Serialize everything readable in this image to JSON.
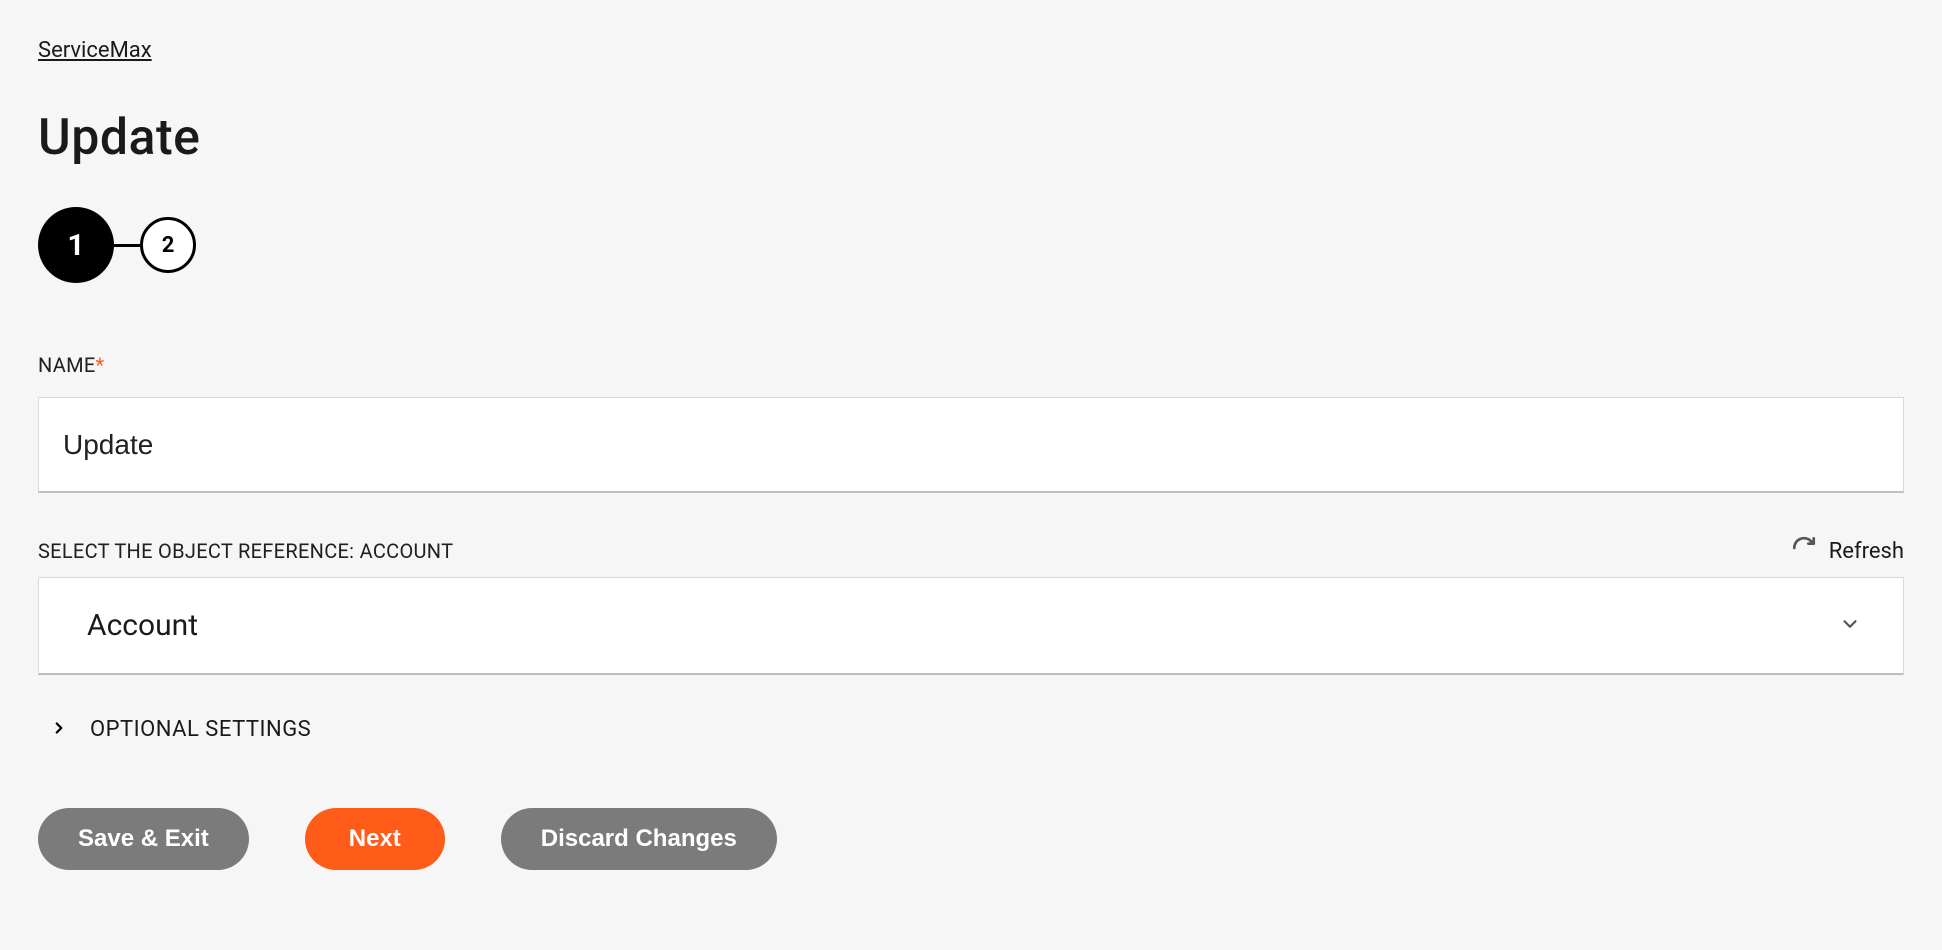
{
  "breadcrumb": "ServiceMax",
  "page_title": "Update",
  "stepper": {
    "steps": [
      "1",
      "2"
    ],
    "active_index": 0
  },
  "fields": {
    "name": {
      "label": "NAME",
      "required": true,
      "value": "Update"
    },
    "object_reference": {
      "label": "SELECT THE OBJECT REFERENCE: ACCOUNT",
      "selected": "Account",
      "refresh_label": "Refresh"
    }
  },
  "optional_settings": {
    "label": "OPTIONAL SETTINGS",
    "expanded": false
  },
  "buttons": {
    "save_exit": "Save & Exit",
    "next": "Next",
    "discard": "Discard Changes"
  },
  "colors": {
    "accent": "#ff5c1a",
    "neutral_button": "#7b7b7b",
    "page_bg": "#f6f6f6"
  }
}
